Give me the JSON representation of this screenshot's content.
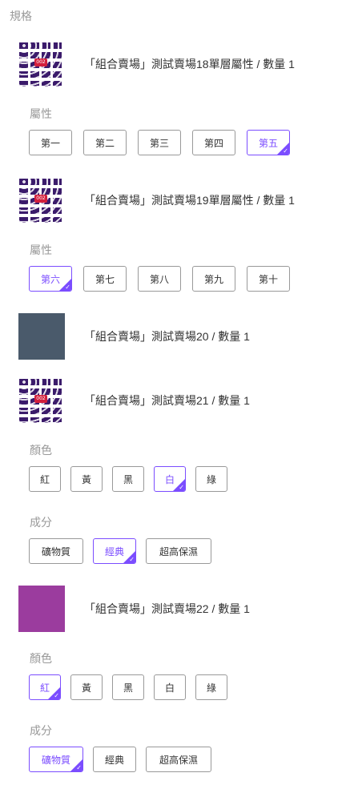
{
  "section_title": "規格",
  "products": [
    {
      "title": "「組合賣場」測試賣場18單層屬性 / 數量 1",
      "thumb": "pattern",
      "attributes": [
        {
          "label": "屬性",
          "options": [
            "第一",
            "第二",
            "第三",
            "第四",
            "第五"
          ],
          "selected": 4
        }
      ]
    },
    {
      "title": "「組合賣場」測試賣場19單層屬性 / 數量 1",
      "thumb": "pattern",
      "attributes": [
        {
          "label": "屬性",
          "options": [
            "第六",
            "第七",
            "第八",
            "第九",
            "第十"
          ],
          "selected": 0
        }
      ]
    },
    {
      "title": "「組合賣場」測試賣場20 / 數量 1",
      "thumb": "slate",
      "attributes": []
    },
    {
      "title": "「組合賣場」測試賣場21 / 數量 1",
      "thumb": "pattern",
      "attributes": [
        {
          "label": "顏色",
          "options": [
            "紅",
            "黃",
            "黑",
            "白",
            "綠"
          ],
          "selected": 3
        },
        {
          "label": "成分",
          "options": [
            "礦物質",
            "經典",
            "超高保濕"
          ],
          "selected": 1
        }
      ]
    },
    {
      "title": "「組合賣場」測試賣場22 / 數量 1",
      "thumb": "purple",
      "attributes": [
        {
          "label": "顏色",
          "options": [
            "紅",
            "黃",
            "黑",
            "白",
            "綠"
          ],
          "selected": 0
        },
        {
          "label": "成分",
          "options": [
            "礦物質",
            "經典",
            "超高保濕"
          ],
          "selected": 0
        }
      ]
    }
  ],
  "thumb_mark_text": "002",
  "check_glyph": "✓",
  "colors": {
    "accent": "#7b4dff",
    "muted_text": "#999999",
    "text": "#333333",
    "border": "#999999"
  }
}
